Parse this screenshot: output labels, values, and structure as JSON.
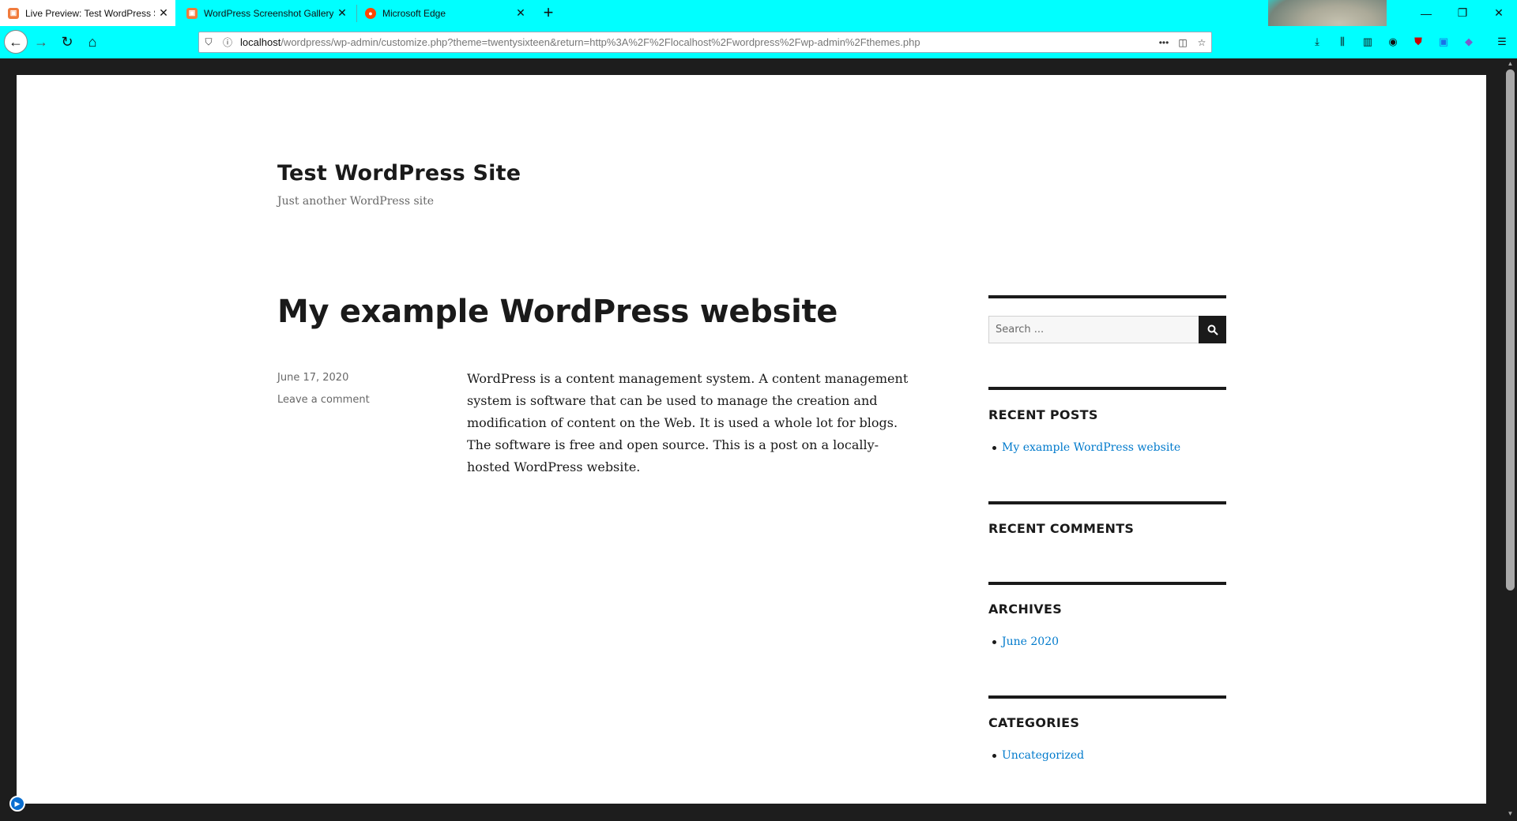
{
  "browser": {
    "tabs": [
      {
        "title": "Live Preview: Test WordPress S",
        "active": true,
        "favicon_color": "#f07b3c"
      },
      {
        "title": "WordPress Screenshot Gallery",
        "active": false,
        "favicon_color": "#f07b3c"
      },
      {
        "title": "Microsoft Edge",
        "active": false,
        "favicon_color": "#ff4500"
      }
    ],
    "new_tab_icon": "plus-icon",
    "url_host": "localhost",
    "url_path": "/wordpress/wp-admin/customize.php?theme=twentysixteen&return=http%3A%2F%2Flocalhost%2Fwordpress%2Fwp-admin%2Fthemes.php",
    "accent_color": "#00ffff"
  },
  "site": {
    "title": "Test WordPress Site",
    "tagline": "Just another WordPress site"
  },
  "post": {
    "title": "My example WordPress website",
    "date": "June 17, 2020",
    "comment_link": "Leave a comment",
    "body": "WordPress is a content management system. A content management system is software that can be used to manage the creation and modification of content on the Web. It is used a whole lot for blogs. The software is free and open source. This is a post on a locally-hosted WordPress website."
  },
  "sidebar": {
    "search_placeholder": "Search ...",
    "recent_posts_title": "RECENT POSTS",
    "recent_posts": [
      "My example WordPress website"
    ],
    "recent_comments_title": "RECENT COMMENTS",
    "archives_title": "ARCHIVES",
    "archives": [
      "June 2020"
    ],
    "categories_title": "CATEGORIES",
    "categories": [
      "Uncategorized"
    ],
    "link_color": "#007acc"
  }
}
